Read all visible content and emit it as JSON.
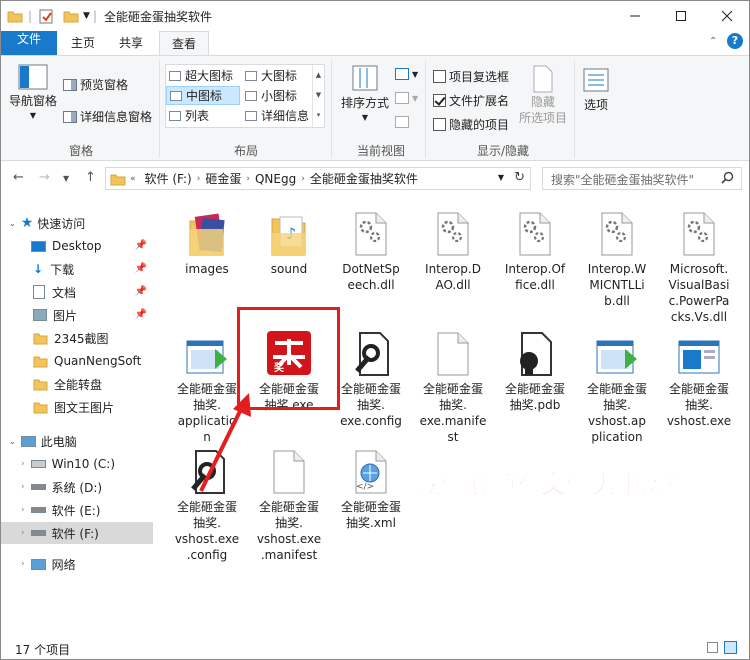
{
  "window": {
    "title": "全能砸金蛋抽奖软件"
  },
  "ribbon_tabs": [
    "文件",
    "主页",
    "共享",
    "查看"
  ],
  "ribbon": {
    "pane": {
      "nav_pane": "导航窗格",
      "preview_pane": "预览窗格",
      "details_pane": "详细信息窗格",
      "group": "窗格"
    },
    "layout": {
      "items": [
        "超大图标",
        "大图标",
        "中图标",
        "小图标",
        "列表",
        "详细信息"
      ],
      "group": "布局"
    },
    "current_view": {
      "sort": "排序方式",
      "group": "当前视图"
    },
    "show_hide": {
      "item_checkboxes": "项目复选框",
      "file_ext": "文件扩展名",
      "hidden_items": "隐藏的项目",
      "hide_selected_1": "隐藏",
      "hide_selected_2": "所选项目",
      "group": "显示/隐藏"
    },
    "options": "选项",
    "checks": {
      "item_checkboxes": false,
      "file_ext": true,
      "hidden_items": false
    }
  },
  "address": {
    "crumbs": [
      "软件 (F:)",
      "砸金蛋",
      "QNEgg",
      "全能砸金蛋抽奖软件"
    ],
    "search_placeholder": "搜索\"全能砸金蛋抽奖软件\""
  },
  "nav": {
    "quick_access": "快速访问",
    "items": [
      "Desktop",
      "下载",
      "文档",
      "图片",
      "2345截图",
      "QuanNengSoft",
      "全能转盘",
      "图文王图片"
    ],
    "this_pc": "此电脑",
    "drives": [
      "Win10 (C:)",
      "系统 (D:)",
      "软件 (E:)",
      "软件 (F:)"
    ],
    "network": "网络"
  },
  "files": [
    {
      "name": "images",
      "icon": "folder-image-icon"
    },
    {
      "name": "sound",
      "icon": "folder-music-icon"
    },
    {
      "name": "DotNetSpeech.dll",
      "icon": "dll-gear-icon"
    },
    {
      "name": "Interop.DAO.dll",
      "icon": "dll-gear-icon"
    },
    {
      "name": "Interop.Office.dll",
      "icon": "dll-gear-icon"
    },
    {
      "name": "Interop.WMICNTLLib.dll",
      "icon": "dll-gear-icon"
    },
    {
      "name": "Microsoft.VisualBasic.PowerPacks.Vs.dll",
      "icon": "dll-gear-icon"
    },
    {
      "name": "全能砸金蛋抽奖.application",
      "icon": "application-manifest-icon"
    },
    {
      "name": "全能砸金蛋抽奖.exe",
      "icon": "app-exe-icon"
    },
    {
      "name": "全能砸金蛋抽奖.exe.config",
      "icon": "config-wrench-icon"
    },
    {
      "name": "全能砸金蛋抽奖.exe.manifest",
      "icon": "blank-file-icon"
    },
    {
      "name": "全能砸金蛋抽奖.pdb",
      "icon": "pdb-file-icon"
    },
    {
      "name": "全能砸金蛋抽奖.vshost.application",
      "icon": "application-manifest-icon"
    },
    {
      "name": "全能砸金蛋抽奖.vshost.exe",
      "icon": "window-exe-icon"
    },
    {
      "name": "全能砸金蛋抽奖.vshost.exe.config",
      "icon": "config-wrench-icon"
    },
    {
      "name": "全能砸金蛋抽奖.vshost.exe.manifest",
      "icon": "blank-file-icon"
    },
    {
      "name": "全能砸金蛋抽奖.xml",
      "icon": "xml-file-icon"
    }
  ],
  "file_labels": [
    "images",
    "sound",
    "DotNetSp\neech.dll",
    "Interop.D\nAO.dll",
    "Interop.Of\nfice.dll",
    "Interop.W\nMICNTLLi\nb.dll",
    "Microsoft.\nVisualBasi\nc.PowerPa\ncks.Vs.dll",
    "全能砸金蛋\n抽奖.\napplicatio\nn",
    "全能砸金蛋\n抽奖.exe",
    "全能砸金蛋\n抽奖.\nexe.config",
    "全能砸金蛋\n抽奖.\nexe.manife\nst",
    "全能砸金蛋\n抽奖.pdb",
    "全能砸金蛋\n抽奖.\nvshost.ap\nplication",
    "全能砸金蛋\n抽奖.\nvshost.exe",
    "全能砸金蛋\n抽奖.\nvshost.exe\n.config",
    "全能砸金蛋\n抽奖.\nvshost.exe\n.manifest",
    "全能砸金蛋\n抽奖.xml"
  ],
  "annotation": "软件必须在文件夹中运行",
  "status": {
    "count": "17 个项目"
  },
  "colors": {
    "accent": "#1979ca",
    "annotation": "#e41e1e"
  }
}
